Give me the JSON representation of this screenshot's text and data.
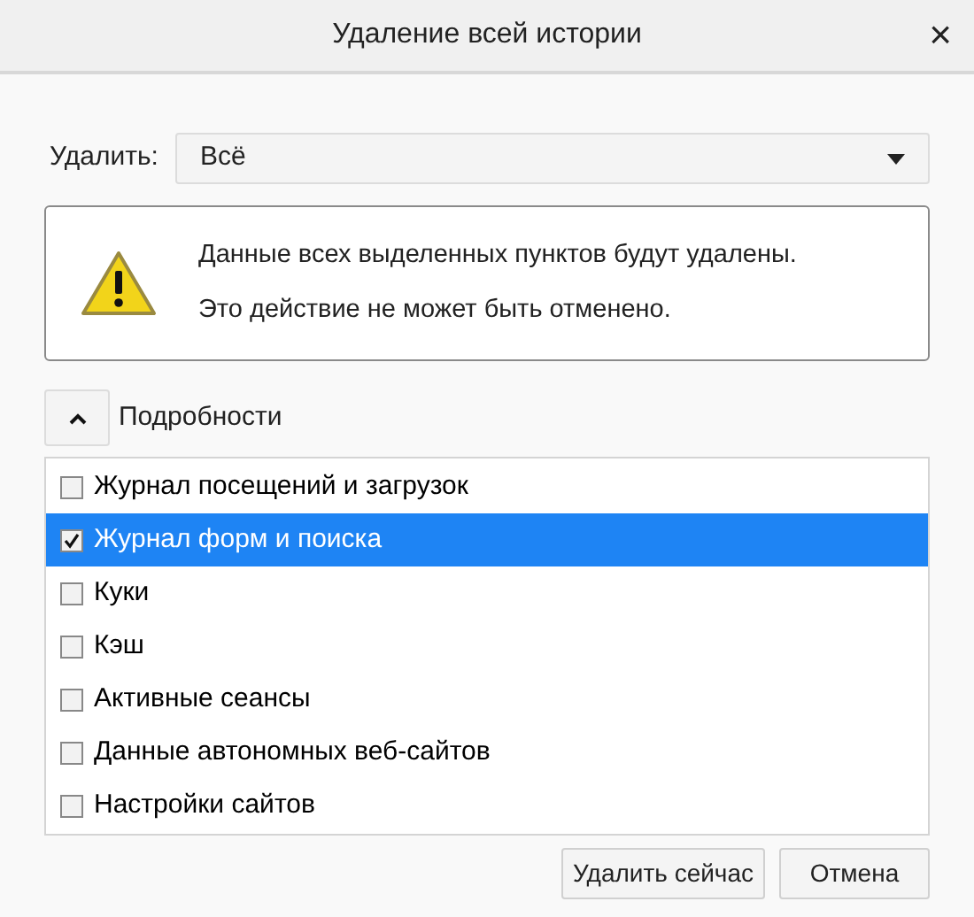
{
  "window": {
    "title": "Удаление всей истории",
    "close": "×"
  },
  "range": {
    "label": "Удалить:",
    "value": "Всё"
  },
  "warning": {
    "lines": [
      "Данные всех выделенных пунктов будут удалены.",
      "Это действие не может быть отменено."
    ]
  },
  "details": {
    "label": "Подробности",
    "expanded": true
  },
  "items": [
    {
      "label": "Журнал посещений и загрузок",
      "checked": false,
      "selected": false
    },
    {
      "label": "Журнал форм и поиска",
      "checked": true,
      "selected": true
    },
    {
      "label": "Куки",
      "checked": false,
      "selected": false
    },
    {
      "label": "Кэш",
      "checked": false,
      "selected": false
    },
    {
      "label": "Активные сеансы",
      "checked": false,
      "selected": false
    },
    {
      "label": "Данные автономных веб-сайтов",
      "checked": false,
      "selected": false
    },
    {
      "label": "Настройки сайтов",
      "checked": false,
      "selected": false
    }
  ],
  "buttons": [
    "Удалить сейчас",
    "Отмена"
  ]
}
